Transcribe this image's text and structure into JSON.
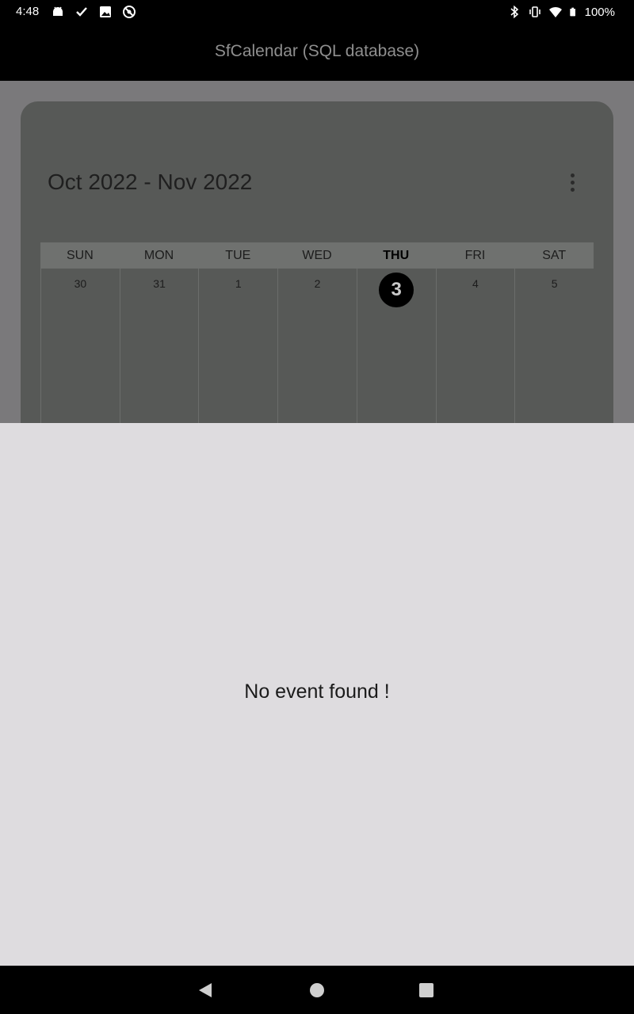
{
  "status_bar": {
    "time": "4:48",
    "battery": "100%",
    "left_icons": [
      "android-icon",
      "check-icon",
      "image-icon",
      "do-not-disturb-icon"
    ],
    "right_icons": [
      "bluetooth-icon",
      "vibrate-icon",
      "wifi-icon",
      "battery-icon"
    ]
  },
  "app_bar": {
    "title": "SfCalendar (SQL database)"
  },
  "calendar": {
    "header": "Oct 2022 - Nov 2022",
    "days_of_week": [
      "SUN",
      "MON",
      "TUE",
      "WED",
      "THU",
      "FRI",
      "SAT"
    ],
    "today_index": 4,
    "dates": [
      "30",
      "31",
      "1",
      "2",
      "3",
      "4",
      "5"
    ]
  },
  "bottom_sheet": {
    "empty_message": "No event found !"
  },
  "colors": {
    "scrim": "#7a797b",
    "card": "#575957",
    "sheet": "#dedcdf",
    "today_circle": "#000000"
  }
}
